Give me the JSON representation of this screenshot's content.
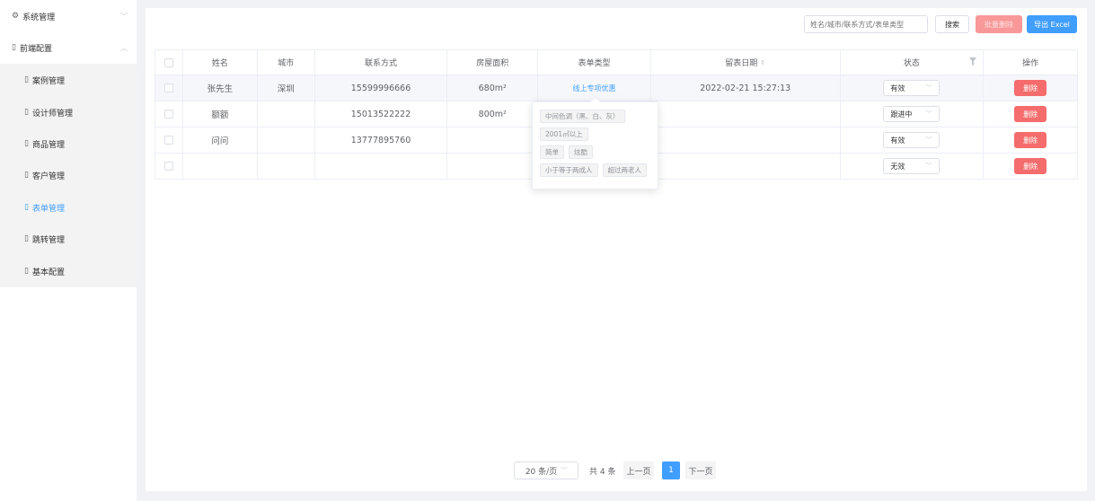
{
  "sidebar": {
    "system": {
      "icon": "gear-icon",
      "label": "系统管理"
    },
    "frontend": {
      "icon": "map-icon",
      "label": "前端配置"
    },
    "items": [
      {
        "icon": "map-icon",
        "label": "案例管理"
      },
      {
        "icon": "map-icon",
        "label": "设计师管理"
      },
      {
        "icon": "map-icon",
        "label": "商品管理"
      },
      {
        "icon": "map-icon",
        "label": "客户管理"
      },
      {
        "icon": "map-icon",
        "label": "表单管理",
        "active": true
      },
      {
        "icon": "map-icon",
        "label": "跳转管理"
      },
      {
        "icon": "map-icon",
        "label": "基本配置"
      }
    ]
  },
  "toolbar": {
    "search_placeholder": "姓名/城市/联系方式/表单类型",
    "search_label": "搜索",
    "batch_delete_label": "批量删除",
    "export_label": "导出 Excel"
  },
  "table": {
    "headers": [
      "",
      "姓名",
      "城市",
      "联系方式",
      "房屋面积",
      "表单类型",
      "留表日期",
      "状态",
      "操作"
    ],
    "rows": [
      {
        "name": "张先生",
        "city": "深圳",
        "phone": "15599996666",
        "area": "680m²",
        "form_type": "线上专项优惠",
        "date": "2022-02-21 15:27:13",
        "status": "有效",
        "action": "删除"
      },
      {
        "name": "额额",
        "city": "",
        "phone": "15013522222",
        "area": "800m²",
        "form_type": "",
        "date": "",
        "status": "跟进中",
        "action": "删除"
      },
      {
        "name": "问问",
        "city": "",
        "phone": "13777895760",
        "area": "",
        "form_type": "",
        "date": "",
        "status": "有效",
        "action": "删除"
      },
      {
        "name": "",
        "city": "",
        "phone": "",
        "area": "",
        "form_type": "",
        "date": "",
        "status": "无效",
        "action": "删除"
      }
    ]
  },
  "popover": {
    "tags": [
      [
        "中间色调（黑、白、灰）"
      ],
      [
        "2001㎡以上"
      ],
      [
        "简单",
        "炫酷"
      ],
      [
        "小于等于两成人",
        "超过两老人"
      ]
    ]
  },
  "pagination": {
    "page_size": "20 条/页",
    "total": "共 4 条",
    "prev": "上一页",
    "current": "1",
    "next": "下一页"
  },
  "colors": {
    "primary": "#409eff",
    "danger": "#f56c6c",
    "danger_light": "#f89898"
  }
}
